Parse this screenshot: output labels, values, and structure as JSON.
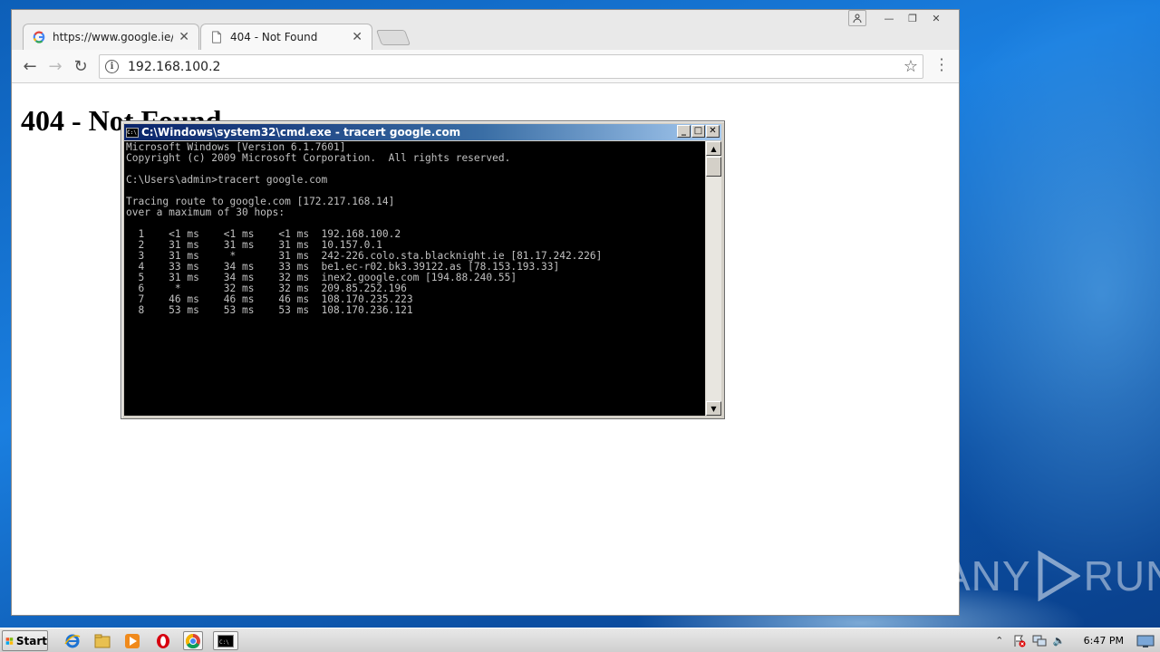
{
  "browser": {
    "tabs": [
      {
        "title": "https://www.google.ie/sear",
        "active": false
      },
      {
        "title": "404 - Not Found",
        "active": true
      }
    ],
    "address": "192.168.100.2"
  },
  "page": {
    "heading": "404 - Not Found"
  },
  "cmd": {
    "title": "C:\\Windows\\system32\\cmd.exe - tracert  google.com",
    "lines": [
      "Microsoft Windows [Version 6.1.7601]",
      "Copyright (c) 2009 Microsoft Corporation.  All rights reserved.",
      "",
      "C:\\Users\\admin>tracert google.com",
      "",
      "Tracing route to google.com [172.217.168.14]",
      "over a maximum of 30 hops:",
      "",
      "  1    <1 ms    <1 ms    <1 ms  192.168.100.2",
      "  2    31 ms    31 ms    31 ms  10.157.0.1",
      "  3    31 ms     *       31 ms  242-226.colo.sta.blacknight.ie [81.17.242.226]",
      "  4    33 ms    34 ms    33 ms  be1.ec-r02.bk3.39122.as [78.153.193.33]",
      "  5    31 ms    34 ms    32 ms  inex2.google.com [194.88.240.55]",
      "  6     *       32 ms    32 ms  209.85.252.196",
      "  7    46 ms    46 ms    46 ms  108.170.235.223",
      "  8    53 ms    53 ms    53 ms  108.170.236.121"
    ]
  },
  "taskbar": {
    "start_label": "Start",
    "clock": "6:47 PM"
  },
  "watermark": {
    "left": "ANY",
    "right": "RUN"
  },
  "colors": {
    "cmd_title_start": "#0a246a",
    "cmd_title_end": "#a6caf0",
    "desktop": "#1a7fe0"
  }
}
